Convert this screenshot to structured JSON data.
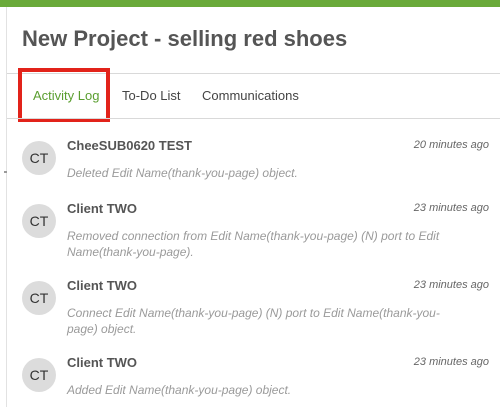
{
  "project": {
    "title": "New Project - selling red shoes"
  },
  "tabs": [
    {
      "label": "Activity Log",
      "active": true
    },
    {
      "label": "To-Do List",
      "active": false
    },
    {
      "label": "Communications",
      "active": false
    }
  ],
  "activity": [
    {
      "initials": "CT",
      "user": "CheeSUB0620 TEST",
      "time": "20 minutes ago",
      "text": "Deleted Edit Name(thank-you-page) object."
    },
    {
      "initials": "CT",
      "user": "Client TWO",
      "time": "23 minutes ago",
      "text": "Removed connection from Edit Name(thank-you-page) (N) port to Edit Name(thank-you-page)."
    },
    {
      "initials": "CT",
      "user": "Client TWO",
      "time": "23 minutes ago",
      "text": "Connect Edit Name(thank-you-page) (N) port to Edit Name(thank-you-page) object."
    },
    {
      "initials": "CT",
      "user": "Client TWO",
      "time": "23 minutes ago",
      "text": "Added Edit Name(thank-you-page) object."
    }
  ],
  "colors": {
    "brand_green": "#6aaa3a",
    "active_tab": "#5a9e2f",
    "highlight_red": "#e2231a"
  }
}
